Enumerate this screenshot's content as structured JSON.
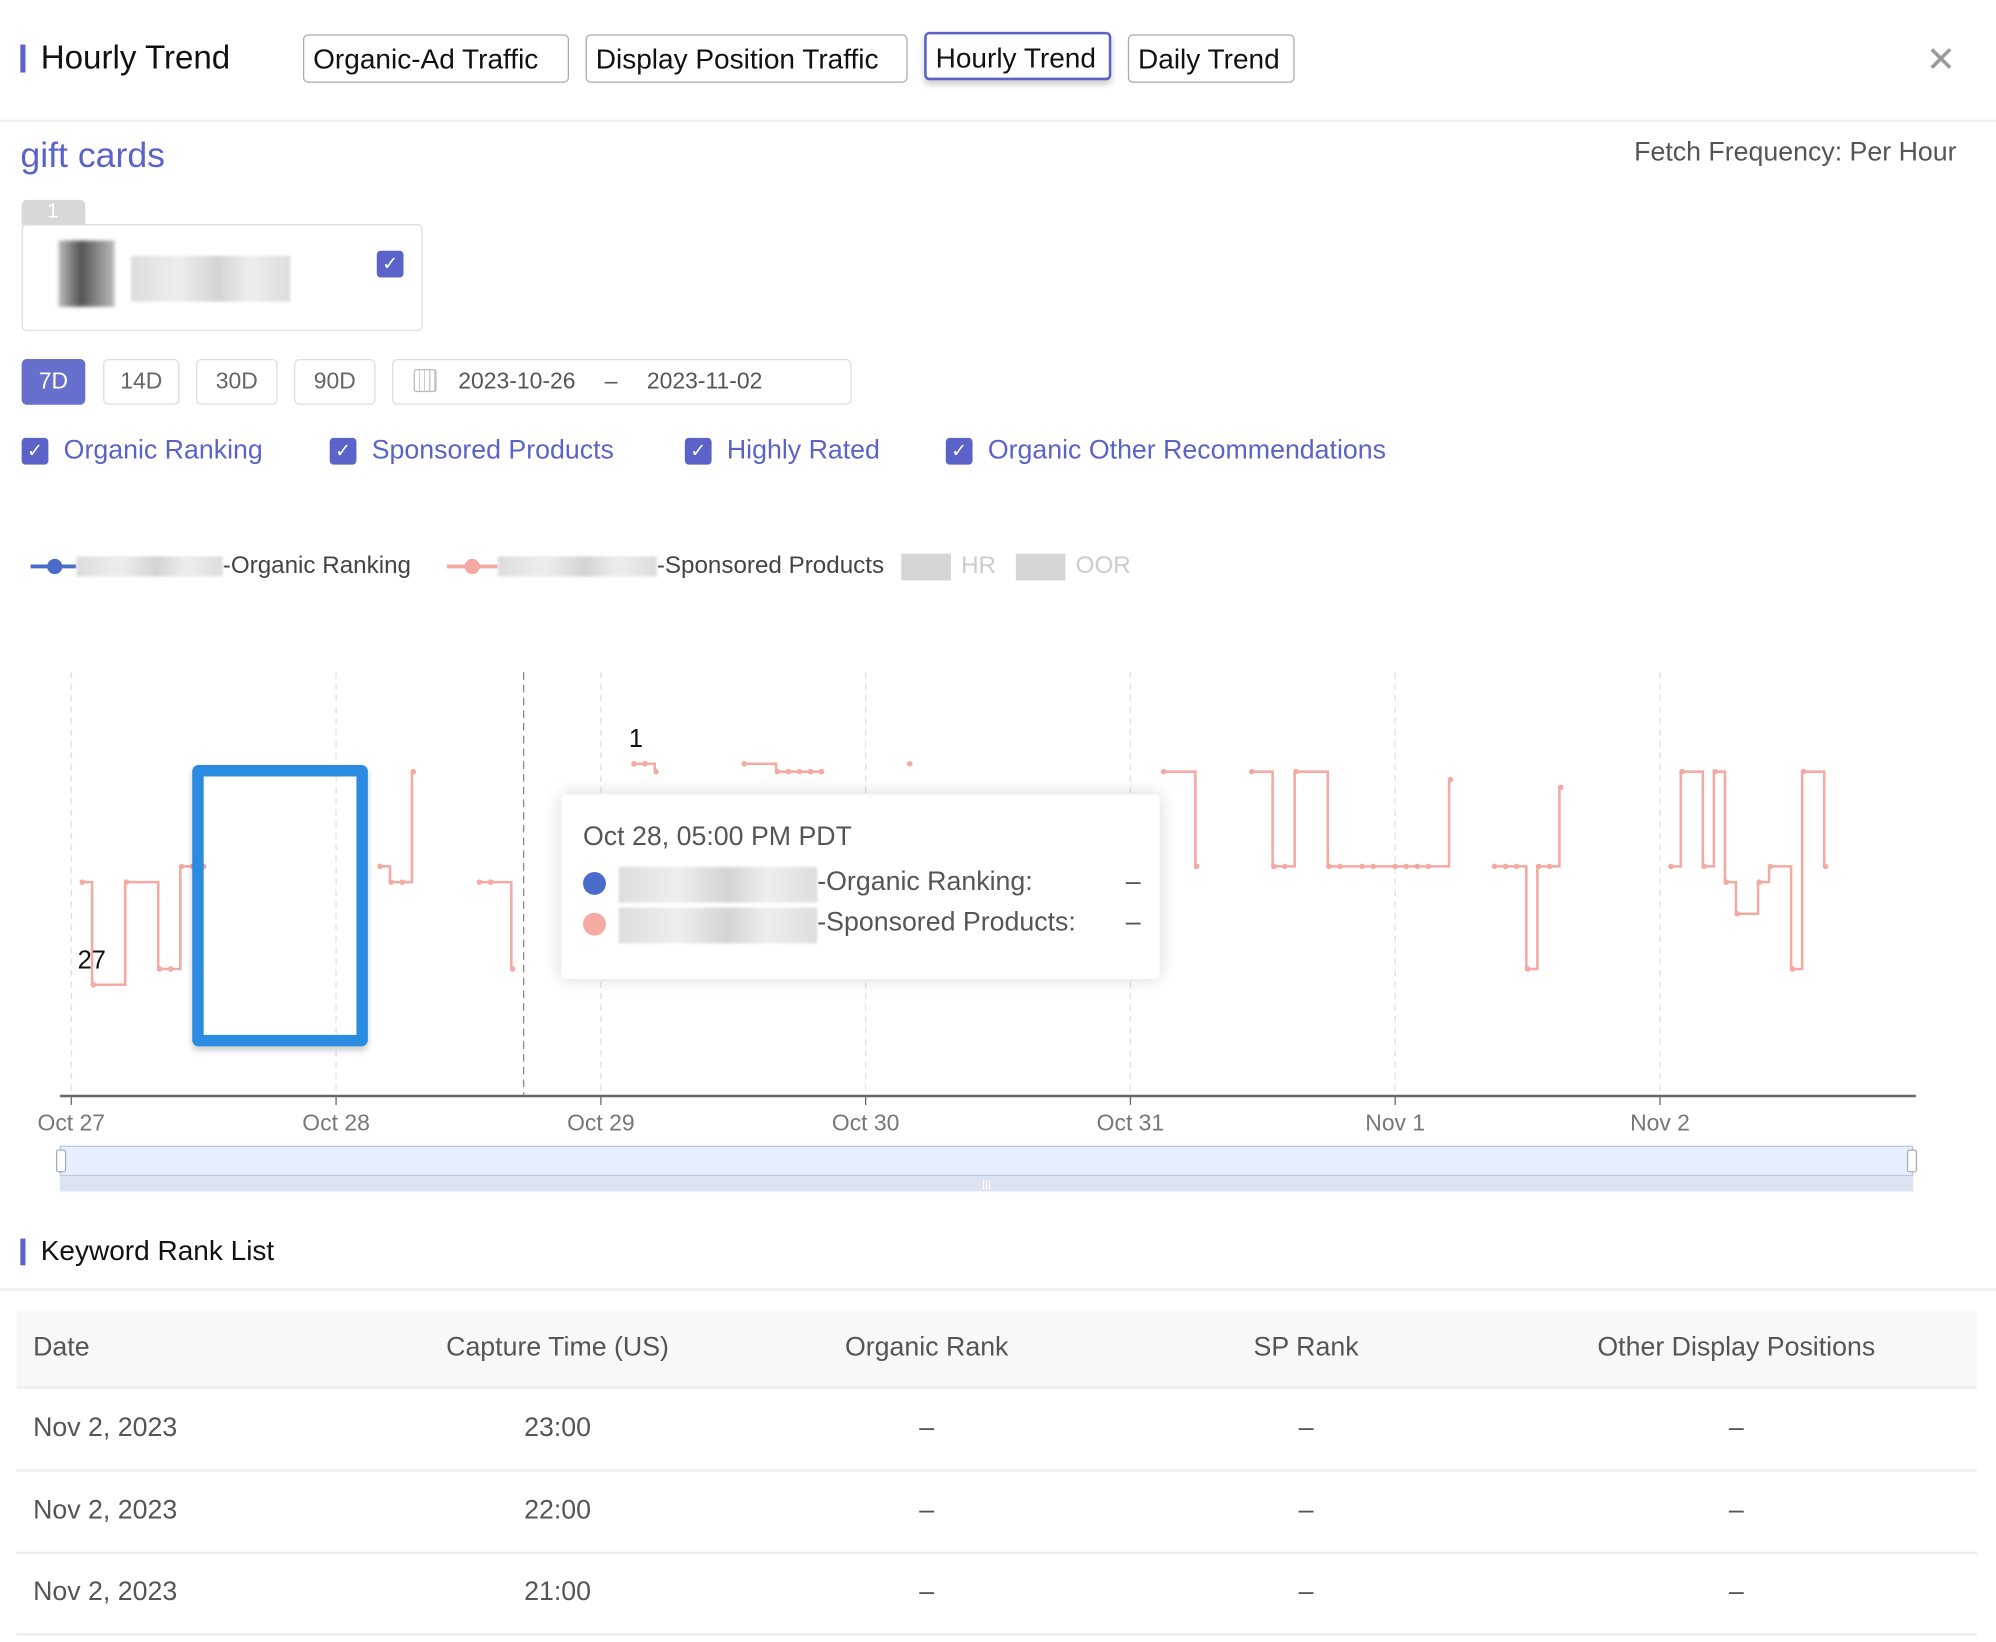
{
  "header": {
    "title": "Hourly Trend",
    "tabs": [
      {
        "label": "Organic-Ad Traffic",
        "active": false
      },
      {
        "label": "Display Position Traffic",
        "active": false
      },
      {
        "label": "Hourly Trend",
        "active": true
      },
      {
        "label": "Daily Trend",
        "active": false
      }
    ],
    "close_icon": "close-icon"
  },
  "keyword": "gift cards",
  "fetch_frequency": "Fetch Frequency: Per Hour",
  "product_card": {
    "index": "1",
    "checked": true
  },
  "range_buttons": [
    {
      "label": "7D",
      "active": true
    },
    {
      "label": "14D",
      "active": false
    },
    {
      "label": "30D",
      "active": false
    },
    {
      "label": "90D",
      "active": false
    }
  ],
  "date_range": {
    "start": "2023-10-26",
    "separator": "–",
    "end": "2023-11-02",
    "icon": "calendar-icon"
  },
  "filters": [
    {
      "label": "Organic Ranking",
      "checked": true
    },
    {
      "label": "Sponsored Products",
      "checked": true
    },
    {
      "label": "Highly Rated",
      "checked": true
    },
    {
      "label": "Organic Other Recommendations",
      "checked": true
    }
  ],
  "colors": {
    "accent": "#5b63c9",
    "organic": "#4a6cc8",
    "sponsored": "#f4a9a3",
    "highlight_box": "#2a8be0"
  },
  "chart_data": {
    "type": "line",
    "step": true,
    "y_inverted": true,
    "legend": {
      "placement": "top-left",
      "entries": [
        {
          "name": "-Organic Ranking",
          "color": "#4a6cc8",
          "enabled": true
        },
        {
          "name": "-Sponsored Products",
          "color": "#f4a9a3",
          "enabled": true
        },
        {
          "name": "HR",
          "enabled": false
        },
        {
          "name": "OOR",
          "enabled": false
        }
      ]
    },
    "x_ticks": [
      "Oct 27",
      "Oct 28",
      "Oct 29",
      "Oct 30",
      "Oct 31",
      "Nov 1",
      "Nov 2"
    ],
    "x_range": [
      "2023-10-27 00:00",
      "2023-11-02 23:00"
    ],
    "value_labels": [
      {
        "text": "1",
        "at": "2023-10-29 03:00"
      },
      {
        "text": "27",
        "at": "2023-10-27 01:00"
      }
    ],
    "series": [
      {
        "name": "-Sponsored Products",
        "points": [
          [
            "2023-10-27 01:00",
            16
          ],
          [
            "2023-10-27 02:00",
            29
          ],
          [
            "2023-10-27 05:00",
            16
          ],
          [
            "2023-10-27 08:00",
            27
          ],
          [
            "2023-10-27 09:00",
            27
          ],
          [
            "2023-10-27 10:00",
            14
          ],
          [
            "2023-10-27 11:00",
            14
          ],
          [
            "2023-10-27 12:00",
            14
          ],
          [
            "2023-10-28 04:00",
            14
          ],
          [
            "2023-10-28 05:00",
            16
          ],
          [
            "2023-10-28 06:00",
            16
          ],
          [
            "2023-10-28 07:00",
            2
          ],
          [
            "2023-10-28 13:00",
            16
          ],
          [
            "2023-10-28 14:00",
            16
          ],
          [
            "2023-10-28 16:00",
            27
          ],
          [
            "2023-10-29 03:00",
            1
          ],
          [
            "2023-10-29 04:00",
            1
          ],
          [
            "2023-10-29 05:00",
            2
          ],
          [
            "2023-10-29 13:00",
            1
          ],
          [
            "2023-10-29 16:00",
            2
          ],
          [
            "2023-10-29 17:00",
            2
          ],
          [
            "2023-10-29 18:00",
            2
          ],
          [
            "2023-10-29 19:00",
            2
          ],
          [
            "2023-10-29 20:00",
            2
          ],
          [
            "2023-10-30 04:00",
            1
          ],
          [
            "2023-10-31 03:00",
            2
          ],
          [
            "2023-10-31 06:00",
            14
          ],
          [
            "2023-10-31 11:00",
            2
          ],
          [
            "2023-10-31 13:00",
            14
          ],
          [
            "2023-10-31 14:00",
            14
          ],
          [
            "2023-10-31 15:00",
            2
          ],
          [
            "2023-10-31 18:00",
            14
          ],
          [
            "2023-10-31 19:00",
            14
          ],
          [
            "2023-10-31 21:00",
            14
          ],
          [
            "2023-10-31 22:00",
            14
          ],
          [
            "2023-11-01 00:00",
            14
          ],
          [
            "2023-11-01 01:00",
            14
          ],
          [
            "2023-11-01 02:00",
            14
          ],
          [
            "2023-11-01 03:00",
            14
          ],
          [
            "2023-11-01 05:00",
            3
          ],
          [
            "2023-11-01 09:00",
            14
          ],
          [
            "2023-11-01 10:00",
            14
          ],
          [
            "2023-11-01 11:00",
            14
          ],
          [
            "2023-11-01 12:00",
            27
          ],
          [
            "2023-11-01 13:00",
            14
          ],
          [
            "2023-11-01 14:00",
            14
          ],
          [
            "2023-11-01 15:00",
            4
          ],
          [
            "2023-11-02 01:00",
            14
          ],
          [
            "2023-11-02 02:00",
            2
          ],
          [
            "2023-11-02 04:00",
            14
          ],
          [
            "2023-11-02 05:00",
            2
          ],
          [
            "2023-11-02 06:00",
            16
          ],
          [
            "2023-11-02 07:00",
            20
          ],
          [
            "2023-11-02 09:00",
            16
          ],
          [
            "2023-11-02 10:00",
            14
          ],
          [
            "2023-11-02 12:00",
            27
          ],
          [
            "2023-11-02 13:00",
            2
          ],
          [
            "2023-11-02 15:00",
            14
          ]
        ]
      },
      {
        "name": "-Organic Ranking",
        "points": []
      }
    ],
    "hover_at": "2023-10-28 17:00",
    "tooltip": {
      "title": "Oct 28, 05:00 PM PDT",
      "rows": [
        {
          "label": "-Organic Ranking:",
          "value": "–"
        },
        {
          "label": "-Sponsored Products:",
          "value": "–"
        }
      ]
    }
  },
  "rank_list": {
    "title": "Keyword Rank List",
    "columns": [
      "Date",
      "Capture Time (US)",
      "Organic Rank",
      "SP Rank",
      "Other Display Positions"
    ],
    "rows": [
      [
        "Nov 2, 2023",
        "23:00",
        "–",
        "–",
        "–"
      ],
      [
        "Nov 2, 2023",
        "22:00",
        "–",
        "–",
        "–"
      ],
      [
        "Nov 2, 2023",
        "21:00",
        "–",
        "–",
        "–"
      ]
    ]
  }
}
